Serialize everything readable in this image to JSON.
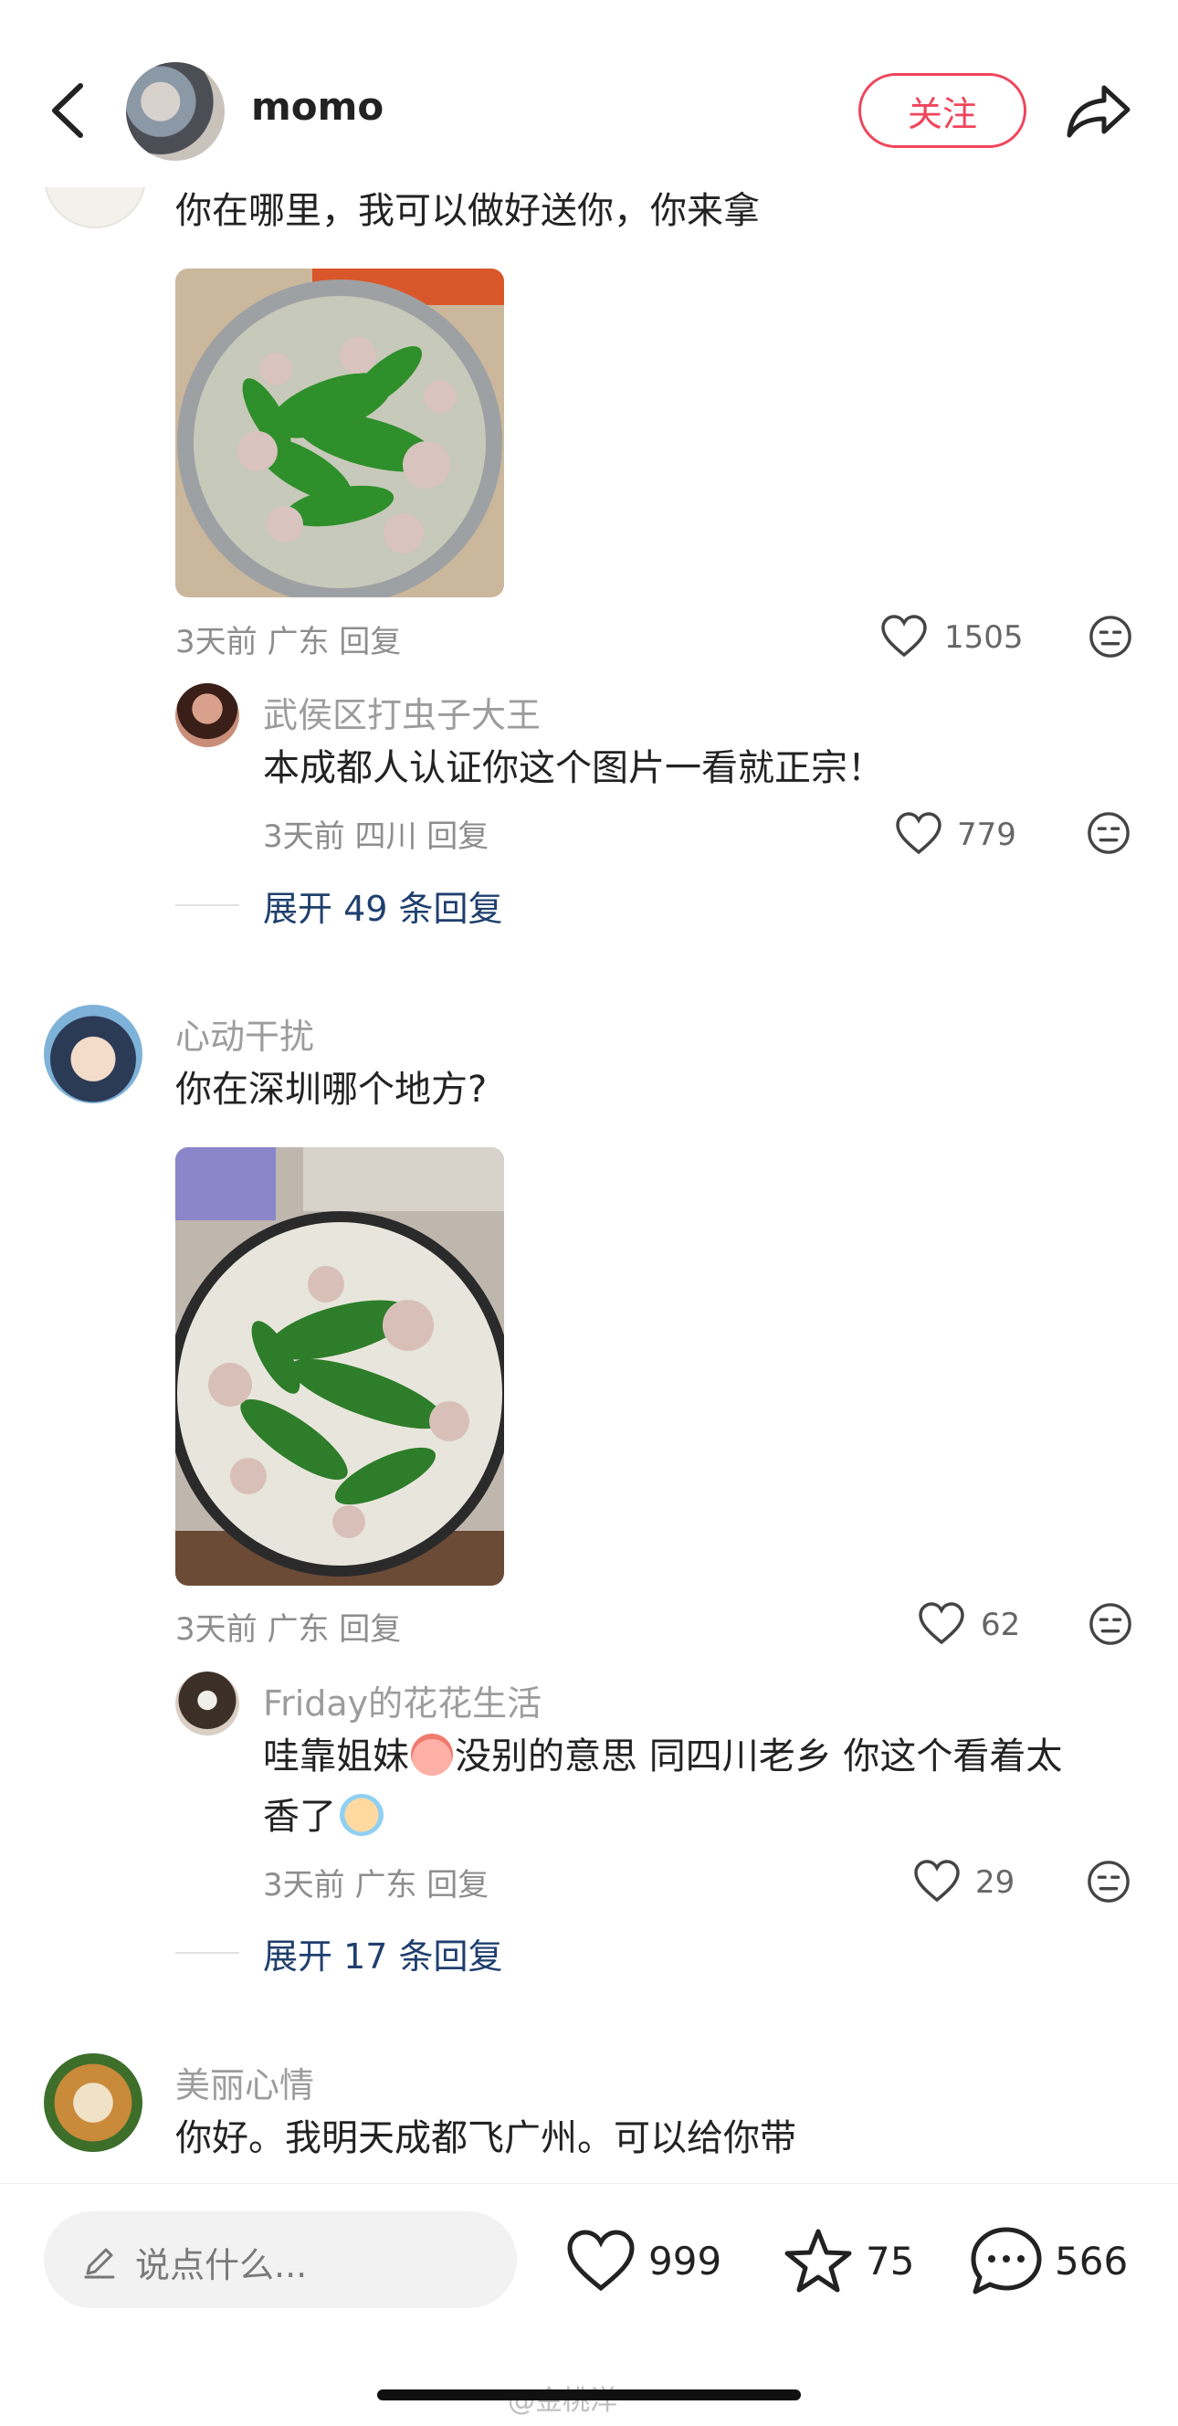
{
  "header": {
    "username": "momo",
    "follow_label": "关注"
  },
  "comment1": {
    "text": "你在哪里，我可以做好送你，你来拿",
    "meta": "3天前 广东 回复",
    "likes": "1505",
    "reply": {
      "name": "武侯区打虫子大王",
      "text": "本成都人认证你这个图片一看就正宗！",
      "meta": "3天前 四川 回复",
      "likes": "779"
    },
    "expand": "展开 49 条回复"
  },
  "comment2": {
    "name": "心动干扰",
    "text": "你在深圳哪个地方?",
    "meta": "3天前 广东 回复",
    "likes": "62",
    "reply": {
      "name": "Friday的花花生活",
      "text_line1": "哇靠姐妹",
      "text_line1b": "没别的意思 同四川老乡 你这个看着太",
      "text_line2": "香了",
      "meta": "3天前 广东 回复",
      "likes": "29"
    },
    "expand": "展开 17 条回复"
  },
  "comment3": {
    "name": "美丽心情",
    "text": "你好。我明天成都飞广州。可以给你带"
  },
  "bottom": {
    "placeholder": "说点什么...",
    "likes": "999",
    "stars": "75",
    "comments": "566",
    "watermark": "@金桃洋"
  },
  "colors": {
    "accent": "#f0455b",
    "link": "#1f3f6e"
  }
}
